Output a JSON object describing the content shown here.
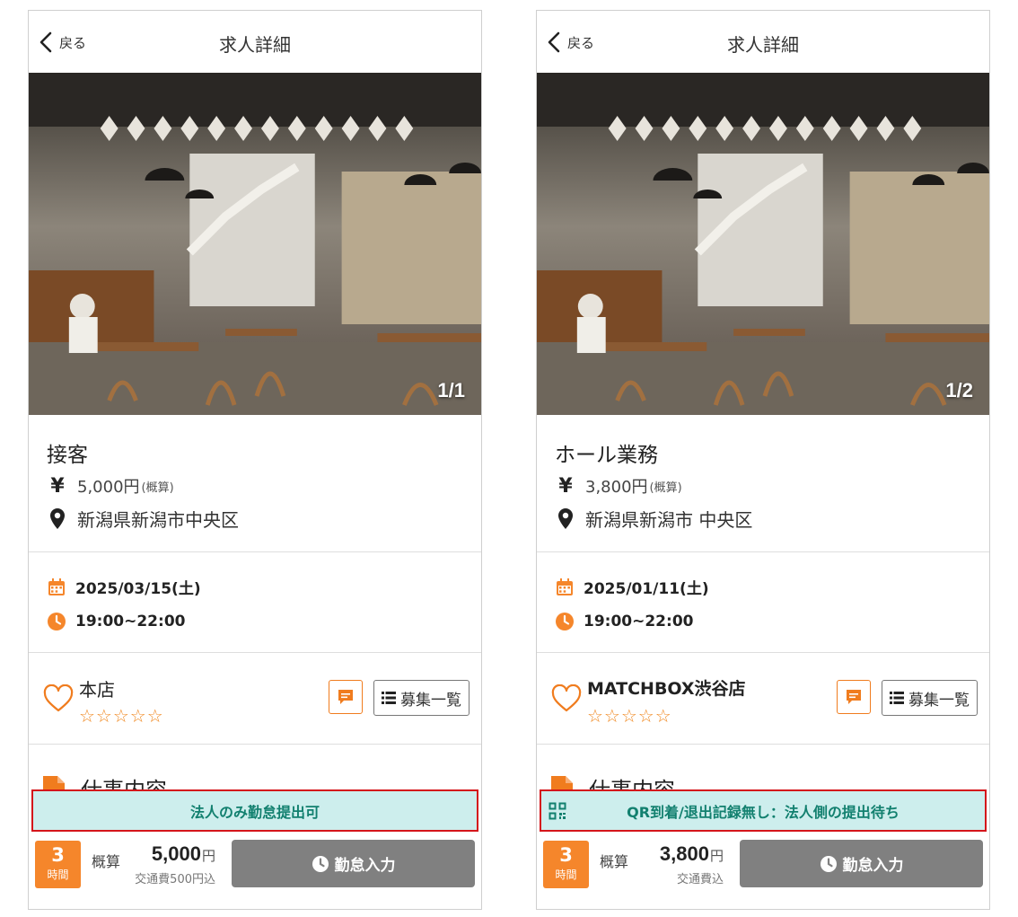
{
  "colors": {
    "accent": "#f5862b",
    "notice_bg": "#cdeeed",
    "notice_text": "#12806f",
    "notice_border": "#d4151b",
    "button_gray": "#808080"
  },
  "screens": [
    {
      "header": {
        "back_label": "戻る",
        "title": "求人詳細"
      },
      "photo_counter": "1/1",
      "job": {
        "title": "接客",
        "wage": "5,000円",
        "wage_note": "(概算)",
        "location": "新潟県新潟市中央区"
      },
      "schedule": {
        "date": "2025/03/15(土)",
        "time": "19:00~22:00"
      },
      "store": {
        "name": "本店",
        "stars": "☆☆☆☆☆",
        "list_button": "募集一覧"
      },
      "section_title": "仕事内容",
      "notice": "法人のみ勤怠提出可",
      "footer": {
        "hours": "3",
        "hours_unit": "時間",
        "estimate_label": "概算",
        "amount": "5,000",
        "amount_unit": "円",
        "transport": "交通費500円込",
        "attendance_button": "勤怠入力"
      }
    },
    {
      "header": {
        "back_label": "戻る",
        "title": "求人詳細"
      },
      "photo_counter": "1/2",
      "job": {
        "title": "ホール業務",
        "wage": "3,800円",
        "wage_note": "(概算)",
        "location": "新潟県新潟市 中央区"
      },
      "schedule": {
        "date": "2025/01/11(土)",
        "time": "19:00~22:00"
      },
      "store": {
        "name": "MATCHBOX渋谷店",
        "stars": "☆☆☆☆☆",
        "list_button": "募集一覧"
      },
      "section_title": "仕事内容",
      "notice": "QR到着/退出記録無し：法人側の提出待ち",
      "footer": {
        "hours": "3",
        "hours_unit": "時間",
        "estimate_label": "概算",
        "amount": "3,800",
        "amount_unit": "円",
        "transport": "交通費込",
        "attendance_button": "勤怠入力"
      }
    }
  ]
}
